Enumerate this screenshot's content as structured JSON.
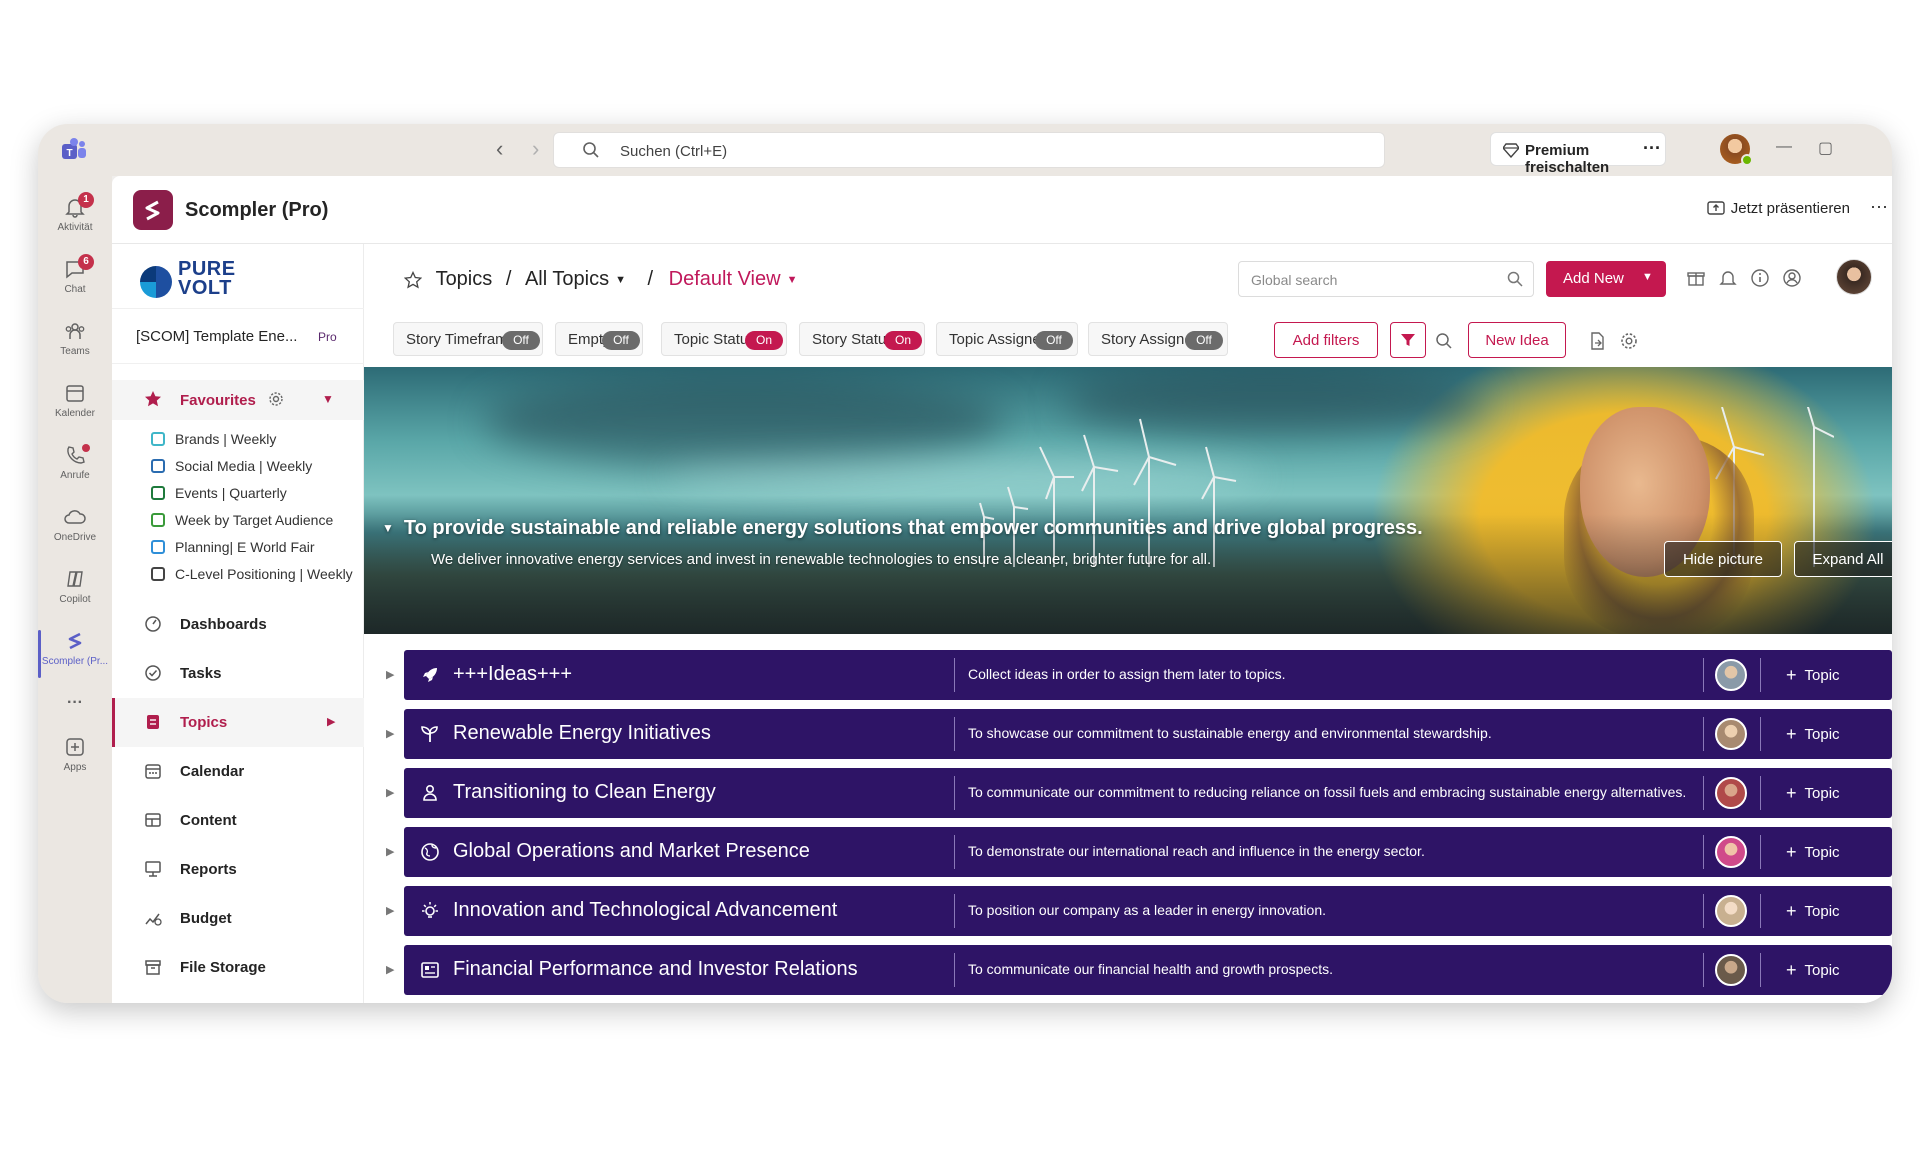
{
  "teams": {
    "search_placeholder": "Suchen (Ctrl+E)",
    "premium_label": "Premium freischalten",
    "more": "···",
    "window_min": "—",
    "window_restore": "▢",
    "rail": [
      {
        "label": "Aktivität",
        "badge": "1",
        "icon": "bell-icon"
      },
      {
        "label": "Chat",
        "badge": "6",
        "icon": "chat-icon"
      },
      {
        "label": "Teams",
        "icon": "teams-icon"
      },
      {
        "label": "Kalender",
        "icon": "calendar-icon"
      },
      {
        "label": "Anrufe",
        "icon": "phone-icon"
      },
      {
        "label": "OneDrive",
        "icon": "cloud-icon"
      },
      {
        "label": "Copilot",
        "icon": "copilot-icon"
      },
      {
        "label": "Scompler (Pr...",
        "icon": "scompler-icon"
      },
      {
        "label": "···"
      },
      {
        "label": "Apps",
        "icon": "apps-icon"
      }
    ]
  },
  "app": {
    "title": "Scompler (Pro)",
    "present_label": "Jetzt präsentieren",
    "more": "···"
  },
  "sidebar": {
    "logo_line1": "PURE",
    "logo_line2": "VOLT",
    "workspace_name": "[SCOM] Template Ene...",
    "workspace_badge": "Pro",
    "favourites_label": "Favourites",
    "favourites": [
      {
        "label": "Brands | Weekly",
        "color": "#3fb6c8"
      },
      {
        "label": "Social Media | Weekly",
        "color": "#2b6cb0"
      },
      {
        "label": "Events | Quarterly",
        "color": "#1e7a3c"
      },
      {
        "label": "Week by Target Audience",
        "color": "#3a9a3a"
      },
      {
        "label": "Planning| E World Fair",
        "color": "#2f8fd8"
      },
      {
        "label": "C-Level Positioning | Weekly",
        "color": "#444444"
      }
    ],
    "menu": [
      {
        "label": "Dashboards",
        "icon": "dashboard-icon"
      },
      {
        "label": "Tasks",
        "icon": "check-circle-icon"
      },
      {
        "label": "Topics",
        "icon": "topics-icon",
        "active": true
      },
      {
        "label": "Calendar",
        "icon": "calendar-icon"
      },
      {
        "label": "Content",
        "icon": "content-icon"
      },
      {
        "label": "Reports",
        "icon": "reports-icon"
      },
      {
        "label": "Budget",
        "icon": "budget-icon"
      },
      {
        "label": "File Storage",
        "icon": "file-storage-icon"
      }
    ]
  },
  "header": {
    "crumb_topics": "Topics",
    "crumb_sep": "/",
    "crumb_all": "All Topics",
    "crumb_view": "Default View",
    "global_search_placeholder": "Global search",
    "add_new_label": "Add New"
  },
  "filters": [
    {
      "label": "Story Timeframe",
      "state": "Off"
    },
    {
      "label": "Empty",
      "state": "Off"
    },
    {
      "label": "Topic Status",
      "state": "On"
    },
    {
      "label": "Story Status",
      "state": "On"
    },
    {
      "label": "Topic Assignee",
      "state": "Off"
    },
    {
      "label": "Story Assignee",
      "state": "Off"
    }
  ],
  "toolbar": {
    "add_filters_label": "Add filters",
    "new_idea_label": "New Idea"
  },
  "banner": {
    "mission": "To provide sustainable and reliable energy solutions that empower communities and drive global progress.",
    "subtitle": "We deliver innovative energy services and invest in renewable technologies to ensure a cleaner, brighter future for all.",
    "hide_picture_label": "Hide picture",
    "expand_all_label": "Expand All"
  },
  "topics": [
    {
      "name": "+++Ideas+++",
      "description": "Collect ideas in order to assign them later to topics.",
      "icon": "rocket-icon",
      "avatar_color": "#8a9aa8",
      "add_label": "Topic"
    },
    {
      "name": "Renewable Energy Initiatives",
      "description": "To showcase our commitment to sustainable energy and environmental stewardship.",
      "icon": "sprout-icon",
      "avatar_color": "#a88a70",
      "add_label": "Topic"
    },
    {
      "name": "Transitioning to Clean Energy",
      "description": "To communicate our commitment to reducing reliance on fossil fuels and embracing sustainable energy alternatives.",
      "icon": "person-icon",
      "avatar_color": "#b04a4a",
      "add_label": "Topic"
    },
    {
      "name": "Global Operations and Market Presence",
      "description": "To demonstrate our international reach and influence in the energy sector.",
      "icon": "globe-icon",
      "avatar_color": "#d04a8a",
      "add_label": "Topic"
    },
    {
      "name": "Innovation and Technological Advancement",
      "description": "To position our company as a leader in energy innovation.",
      "icon": "lightbulb-icon",
      "avatar_color": "#c8b090",
      "add_label": "Topic"
    },
    {
      "name": "Financial Performance and Investor Relations",
      "description": "To communicate our financial health and growth prospects.",
      "icon": "newspaper-icon",
      "avatar_color": "#6a5a4a",
      "add_label": "Topic"
    }
  ]
}
